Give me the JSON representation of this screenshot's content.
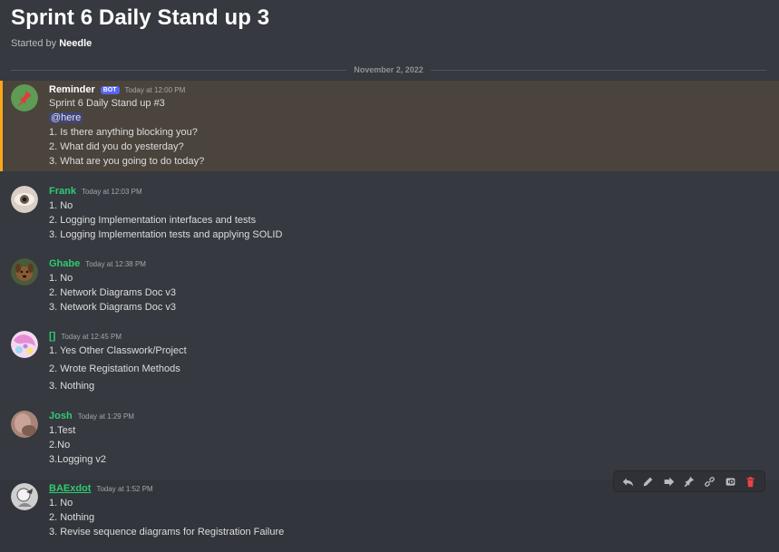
{
  "thread": {
    "title": "Sprint 6 Daily Stand up 3",
    "started_by_prefix": "Started by ",
    "started_by_user": "Needle"
  },
  "date_divider": "November 2, 2022",
  "messages": [
    {
      "author": "Reminder",
      "bot_tag": "BOT",
      "timestamp": "Today at 12:00 PM",
      "lines": [
        "Sprint 6 Daily Stand up #3",
        "@here",
        "1. Is there anything blocking you?",
        "2. What did you do yesterday?",
        "3. What are you going to do today?"
      ]
    },
    {
      "author": "Frank",
      "timestamp": "Today at 12:03 PM",
      "lines": [
        "1. No",
        "2. Logging Implementation interfaces and tests",
        "3. Logging Implementation tests and applying SOLID"
      ]
    },
    {
      "author": "Ghabe",
      "timestamp": "Today at 12:38 PM",
      "lines": [
        "1. No",
        "2. Network Diagrams Doc v3",
        "3. Network Diagrams Doc v3"
      ]
    },
    {
      "author": "[]",
      "timestamp": "Today at 12:45 PM",
      "lines": [
        "1. Yes Other Classwork/Project",
        "2. Wrote Registation Methods",
        "3. Nothing"
      ]
    },
    {
      "author": "Josh",
      "timestamp": "Today at 1:29 PM",
      "lines": [
        "1.Test",
        "2.No",
        "3.Logging v2"
      ]
    },
    {
      "author": "BAExdot",
      "timestamp": "Today at 1:52 PM",
      "lines": [
        "1. No",
        "2. Nothing",
        "3. Revise sequence diagrams for Registration Failure"
      ]
    }
  ],
  "toolbar_icons": [
    "reply-icon",
    "edit-icon",
    "forward-icon",
    "pin-icon",
    "link-icon",
    "copy-id-icon",
    "delete-icon"
  ],
  "colors": {
    "background": "#36393f",
    "highlight": "#4b443c",
    "highlight_border": "#faa81a",
    "username_green": "#2ecc71",
    "bot_tag": "#5865f2",
    "delete": "#ed4245"
  }
}
